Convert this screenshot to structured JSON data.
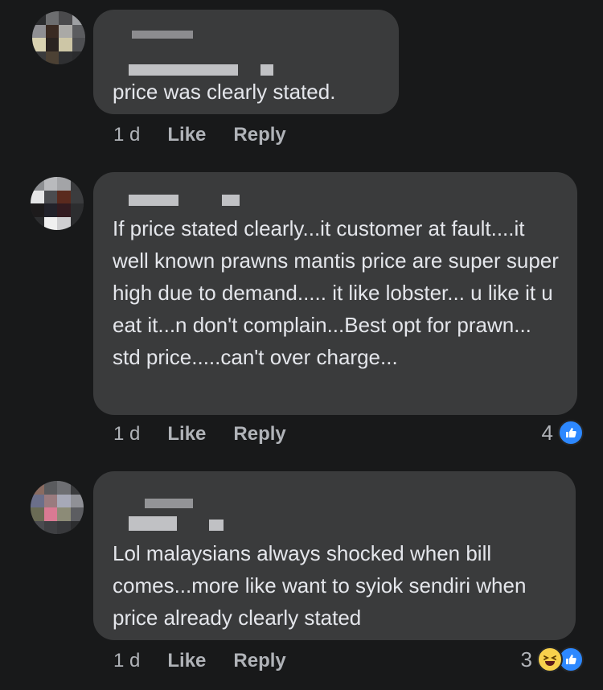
{
  "comments": [
    {
      "text": "price was clearly stated.",
      "time": "1 d",
      "like_label": "Like",
      "reply_label": "Reply",
      "reaction_count": "",
      "reactions": []
    },
    {
      "text": "If price stated clearly...it customer at fault....it well known prawns mantis price are super super high due to demand..... it like lobster... u like it u eat it...n don't complain...Best opt for prawn... std price.....can't over charge...",
      "time": "1 d",
      "like_label": "Like",
      "reply_label": "Reply",
      "reaction_count": "4",
      "reactions": [
        "like-icon"
      ]
    },
    {
      "text": "Lol malaysians always shocked when bill comes...more like want to syiok sendiri when price already clearly stated",
      "time": "1 d",
      "like_label": "Like",
      "reply_label": "Reply",
      "reaction_count": "3",
      "reactions": [
        "haha-icon",
        "like-icon"
      ]
    }
  ],
  "colors": {
    "background": "#18191a",
    "bubble": "#3a3b3c",
    "text": "#e4e6eb",
    "secondary_text": "#b0b3b8",
    "like_blue": "#2d88ff",
    "haha_yellow": "#f7d04c"
  }
}
